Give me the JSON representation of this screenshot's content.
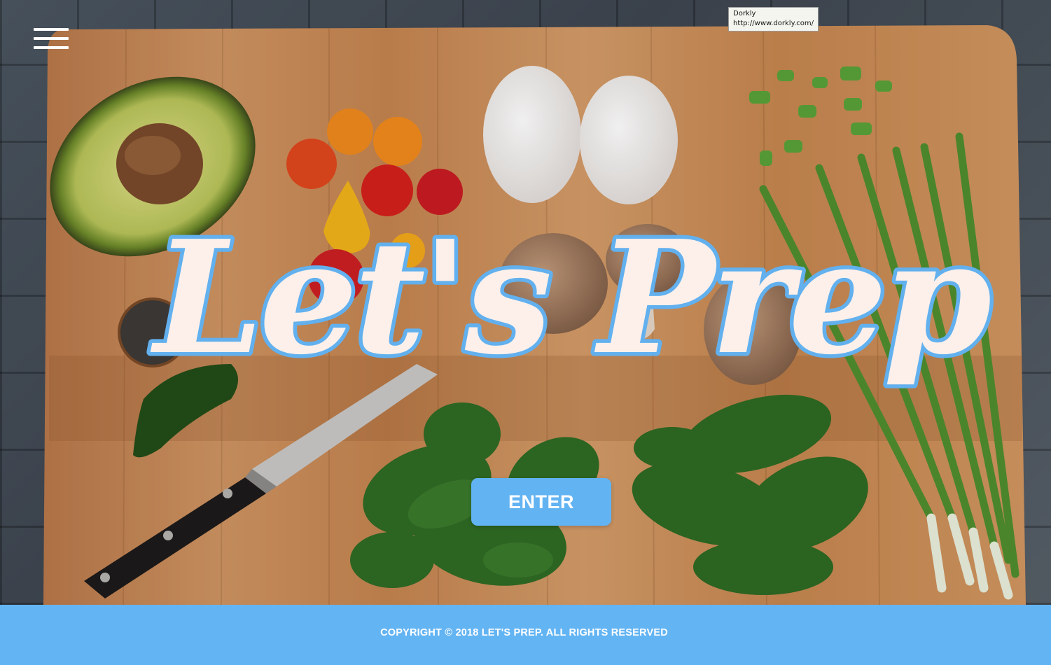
{
  "header": {
    "menu_icon": "hamburger-menu-icon"
  },
  "tooltip": {
    "title": "Dorkly",
    "url": "http://www.dorkly.com/"
  },
  "hero": {
    "logo_text": "Let's Prep",
    "enter_label": "ENTER"
  },
  "footer": {
    "copyright": "COPYRIGHT © 2018 LET'S PREP. ALL RIGHTS RESERVED"
  },
  "colors": {
    "accent": "#63b4f3",
    "logo_fill": "#fdf0ea",
    "logo_outline": "#62b0ee",
    "board": "#c98a55"
  }
}
